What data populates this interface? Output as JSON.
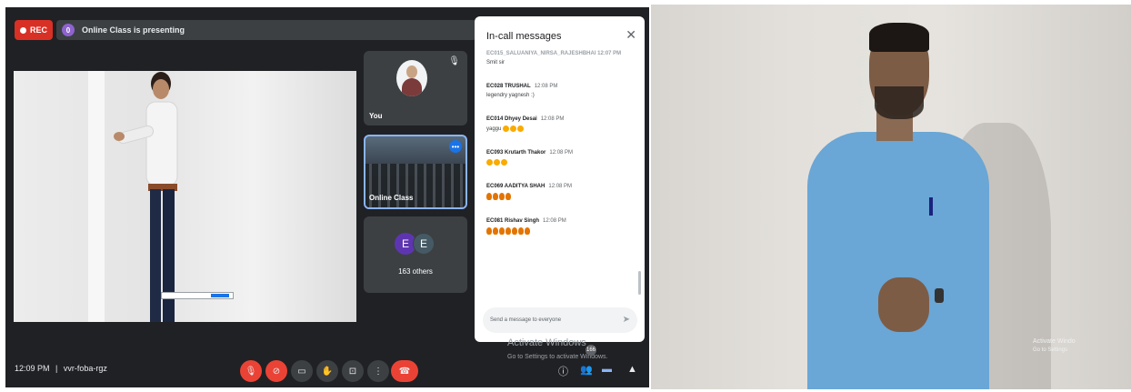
{
  "meet": {
    "rec_label": "REC",
    "presenting_badge": "0",
    "presenting_text": "Online Class is presenting",
    "tiles": {
      "you_label": "You",
      "class_label": "Online Class",
      "others_avatar_1": "E",
      "others_avatar_2": "E",
      "others_label": "163 others"
    },
    "chat": {
      "title": "In-call messages",
      "close": "✕",
      "partial_header": "EC015_SALUANIYA_NIRSA_RAJESHBHAI  12:07 PM",
      "partial_text": "Smit sir",
      "messages": [
        {
          "name": "EC028 TRUSHAL",
          "time": "12:08 PM",
          "text": "legendry yagnesh :)",
          "emoji": "",
          "emoji_count": 0
        },
        {
          "name": "EC014 Dhyey Desai",
          "time": "12:08 PM",
          "text": "yaggu",
          "emoji": "smile",
          "emoji_count": 3
        },
        {
          "name": "EC093 Krutarth Thakor",
          "time": "12:08 PM",
          "text": "",
          "emoji": "smile",
          "emoji_count": 3
        },
        {
          "name": "EC069 AADITYA SHAH",
          "time": "12:08 PM",
          "text": "",
          "emoji": "fire",
          "emoji_count": 4
        },
        {
          "name": "EC081 Rishav Singh",
          "time": "12:08 PM",
          "text": "",
          "emoji": "fire",
          "emoji_count": 7
        }
      ],
      "input_placeholder": "Send a message to everyone"
    },
    "bottom": {
      "time": "12:09 PM",
      "separator": "|",
      "meeting_code": "vvr-foba-rgz",
      "participants_badge": "166"
    },
    "watermark_line1": "Activate Windows",
    "watermark_line2": "Go to Settings to activate Windows."
  },
  "camera": {
    "watermark_line1": "Activate Windo",
    "watermark_line2": "Go to Settings"
  },
  "colors": {
    "meet_bg": "#202124",
    "rec_red": "#d93025",
    "accent_blue": "#1a73e8",
    "end_call": "#ea4335",
    "shirt_blue": "#6aa6d6"
  }
}
